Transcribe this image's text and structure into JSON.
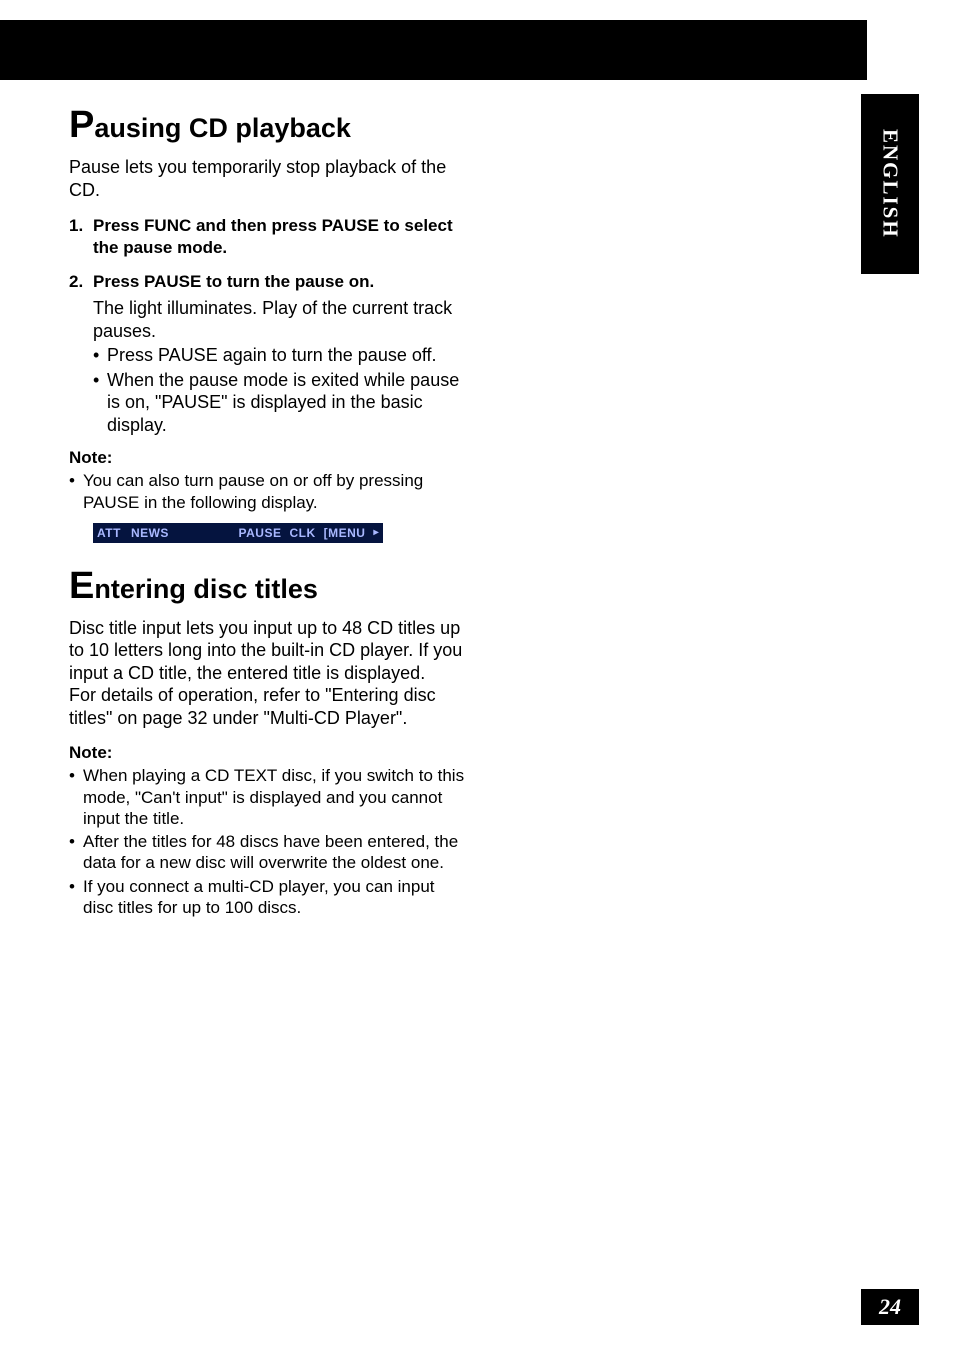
{
  "side_tab": "ENGLISH",
  "page_number": "24",
  "lcd": {
    "att": "ATT",
    "news": "NEWS",
    "pause": "PAUSE",
    "clk": "CLK",
    "menu": "[MENU",
    "arrow": "▸"
  },
  "section1": {
    "title_first": "P",
    "title_rest": "ausing CD playback",
    "intro": "Pause lets you temporarily stop playback of the CD.",
    "step1_num": "1.",
    "step1_text": "Press FUNC and then press PAUSE to select the pause mode.",
    "step2_num": "2.",
    "step2_text": "Press PAUSE to turn the pause on.",
    "step2_body": "The light illuminates. Play of the current track pauses.",
    "step2_sub1": "Press PAUSE again to turn the pause off.",
    "step2_sub2": "When the pause mode is exited while pause is on, \"PAUSE\" is displayed in the basic display.",
    "note_label": "Note:",
    "note1": "You can also turn pause on or off by pressing PAUSE in the following display."
  },
  "section2": {
    "title_first": "E",
    "title_rest": "ntering disc titles",
    "intro": "Disc title input lets you input up to 48 CD titles up to 10 letters long into the built-in CD player. If you input a CD title, the entered title is displayed.\nFor details of operation, refer to \"Entering disc titles\" on page 32  under \"Multi-CD Player\".",
    "note_label": "Note:",
    "note1": "When playing a CD TEXT disc, if you switch to this mode, \"Can't input\" is displayed and you cannot input the title.",
    "note2": "After the titles for 48 discs have been entered, the data for a new disc will overwrite the oldest one.",
    "note3": "If you connect a multi-CD player, you can input disc titles for up to 100 discs."
  }
}
